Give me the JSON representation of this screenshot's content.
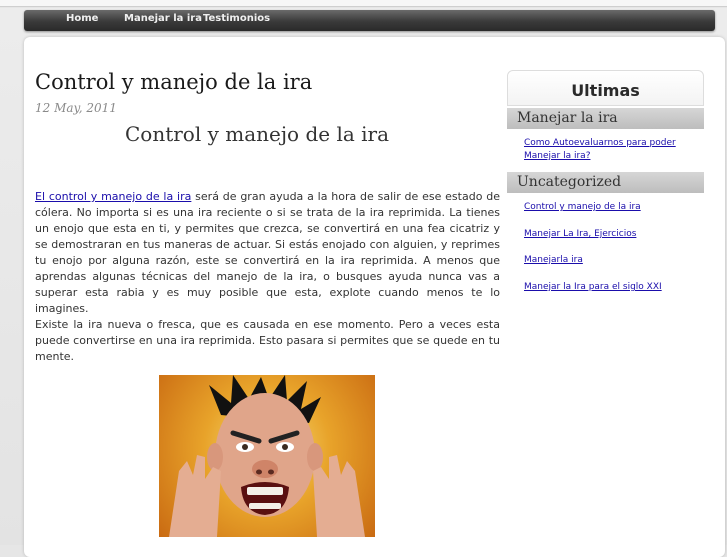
{
  "nav": {
    "home": "Home",
    "ira": "Manejar la ira",
    "separator": "-",
    "testimonios": "Testimonios"
  },
  "post": {
    "title": "Control y manejo de la ira",
    "date": "12 May, 2011",
    "heading": "Control y manejo de la ira",
    "link_text": "El control y manejo de la ira",
    "para1_rest": " será de gran ayuda a la hora de salir de ese estado de cólera. No importa si es una ira reciente o si se trata de la ira reprimida. La tienes un enojo que esta en ti, y permites que crezca, se convertirá en una fea cicatriz y se demostraran en tus maneras de actuar. Si estás enojado con alguien, y reprimes tu enojo por alguna razón, este se convertirá en la ira reprimida. A menos que aprendas  algunas técnicas del manejo de la ira, o busques ayuda nunca vas a superar esta rabia y es muy posible que esta, explote cuando menos te lo imagines.",
    "para2": "Existe la ira nueva o fresca, que es causada en ese momento. Pero a veces esta puede convertirse en una ira reprimida. Esto pasara si permites que se quede en tu mente."
  },
  "sidebar": {
    "title": "Ultimas Publicaciones",
    "category1": "Manejar la ira",
    "cat1_links": [
      "Como Autoevaluarnos para poder Manejar la ira?"
    ],
    "category2": "Uncategorized",
    "cat2_links": [
      "Control y manejo de la ira",
      "Manejar La Ira, Ejercicios",
      "Manejarla ira",
      "Manejar la Ira para el siglo XXI"
    ]
  },
  "colors": {
    "link": "#1a0dab",
    "navbar": "#3a3a3a"
  }
}
